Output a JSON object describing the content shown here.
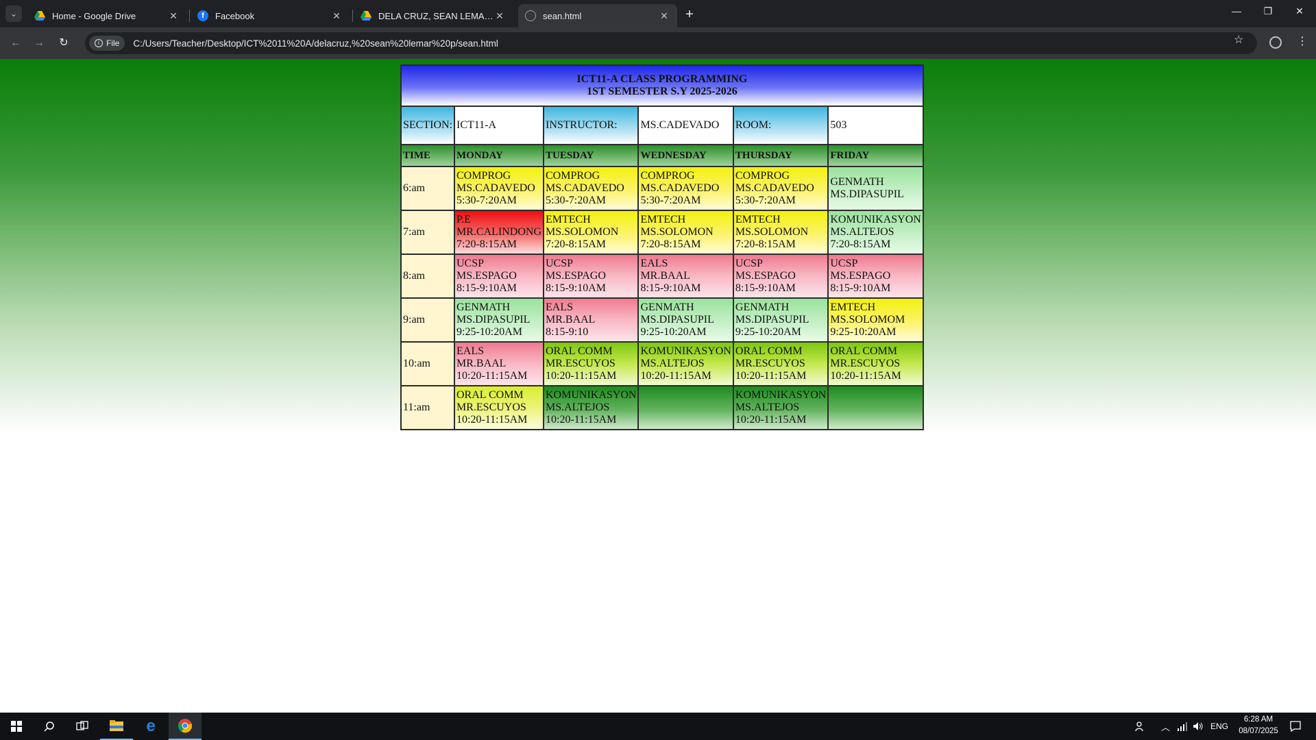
{
  "browser": {
    "tabs": [
      {
        "title": "Home - Google Drive",
        "icon": "google-drive-icon"
      },
      {
        "title": "Facebook",
        "icon": "facebook-icon"
      },
      {
        "title": "DELA CRUZ, SEAN LEMAR P. - G",
        "icon": "google-drive-icon"
      },
      {
        "title": "sean.html",
        "icon": "file-icon"
      }
    ],
    "new_tab": "+",
    "chip_label": "File",
    "url": "C:/Users/Teacher/Desktop/ICT%2011%20A/delacruz,%20sean%20lemar%20p/sean.html"
  },
  "schedule": {
    "title_line1": "ICT11-A CLASS PROGRAMMING",
    "title_line2": "1ST SEMESTER S.Y 2025-2026",
    "section_label": "SECTION:",
    "section_value": "ICT11-A",
    "instructor_label": "INSTRUCTOR:",
    "instructor_value": "MS.CADEVADO",
    "room_label": "ROOM:",
    "room_value": "503",
    "days": [
      "TIME",
      "MONDAY",
      "TUESDAY",
      "WEDNESDAY",
      "THURSDAY",
      "FRIDAY"
    ],
    "rows": [
      {
        "time": "6:am",
        "cells": [
          {
            "color": "#f3f10e",
            "lines": [
              "COMPROG",
              "MS.CADAVEDO",
              "5:30-7:20AM"
            ]
          },
          {
            "color": "#f3f10e",
            "lines": [
              "COMPROG",
              "MS.CADAVEDO",
              "5:30-7:20AM"
            ]
          },
          {
            "color": "#f3f10e",
            "lines": [
              "COMPROG",
              "MS.CADAVEDO",
              "5:30-7:20AM"
            ]
          },
          {
            "color": "#f3f10e",
            "lines": [
              "COMPROG",
              "MS.CADAVEDO",
              "5:30-7:20AM"
            ]
          },
          {
            "color": "#9ae39d",
            "lines": [
              "GENMATH",
              "MS.DIPASUPIL"
            ]
          }
        ]
      },
      {
        "time": "7:am",
        "cells": [
          {
            "color": "#f00f0f",
            "lines": [
              "P.E",
              "MR.CALINDONG",
              "7:20-8:15AM"
            ]
          },
          {
            "color": "#f3f10e",
            "lines": [
              "EMTECH",
              "MS.SOLOMON",
              "7:20-8:15AM"
            ]
          },
          {
            "color": "#f3f10e",
            "lines": [
              "EMTECH",
              "MS.SOLOMON",
              "7:20-8:15AM"
            ]
          },
          {
            "color": "#f3f10e",
            "lines": [
              "EMTECH",
              "MS.SOLOMON",
              "7:20-8:15AM"
            ]
          },
          {
            "color": "#9ae39d",
            "lines": [
              "KOMUNIKASYON",
              "MS.ALTEJOS",
              "7:20-8:15AM"
            ]
          }
        ]
      },
      {
        "time": "8:am",
        "cells": [
          {
            "color": "#f07a90",
            "lines": [
              "UCSP",
              "MS.ESPAGO",
              "8:15-9:10AM"
            ]
          },
          {
            "color": "#f07a90",
            "lines": [
              "UCSP",
              "MS.ESPAGO",
              "8:15-9:10AM"
            ]
          },
          {
            "color": "#f07a90",
            "lines": [
              "EALS",
              "MR.BAAL",
              "8:15-9:10AM"
            ]
          },
          {
            "color": "#f07a90",
            "lines": [
              "UCSP",
              "MS.ESPAGO",
              "8:15-9:10AM"
            ]
          },
          {
            "color": "#f07a90",
            "lines": [
              "UCSP",
              "MS.ESPAGO",
              "8:15-9:10AM"
            ]
          }
        ]
      },
      {
        "time": "9:am",
        "cells": [
          {
            "color": "#9ae39d",
            "lines": [
              "GENMATH",
              "MS.DIPASUPIL",
              "9:25-10:20AM"
            ]
          },
          {
            "color": "#f07a90",
            "lines": [
              "EALS",
              "MR.BAAL",
              "8:15-9:10"
            ]
          },
          {
            "color": "#9ae39d",
            "lines": [
              "GENMATH",
              "MS.DIPASUPIL",
              "9:25-10:20AM"
            ]
          },
          {
            "color": "#9ae39d",
            "lines": [
              "GENMATH",
              "MS.DIPASUPIL",
              "9:25-10:20AM"
            ]
          },
          {
            "color": "#f3f10e",
            "lines": [
              "EMTECH",
              "MS.SOLOMOM",
              "9:25-10:20AM"
            ]
          }
        ]
      },
      {
        "time": "10:am",
        "cells": [
          {
            "color": "#f07a90",
            "lines": [
              "EALS",
              "MR.BAAL",
              "10:20-11:15AM"
            ]
          },
          {
            "color": "#7dc70f",
            "lines": [
              "ORAL COMM",
              "MR.ESCUYOS",
              "10:20-11:15AM"
            ]
          },
          {
            "color": "#7dc70f",
            "lines": [
              "KOMUNIKASYON",
              "MS.ALTEJOS",
              "10:20-11:15AM"
            ]
          },
          {
            "color": "#7dc70f",
            "lines": [
              "ORAL COMM",
              "MR.ESCUYOS",
              "10:20-11:15AM"
            ]
          },
          {
            "color": "#7dc70f",
            "lines": [
              "ORAL COMM",
              "MR.ESCUYOS",
              "10:20-11:15AM"
            ]
          }
        ]
      },
      {
        "time": "11:am",
        "cells": [
          {
            "color": "#d9ee2c",
            "lines": [
              "ORAL COMM",
              "MR.ESCUYOS",
              "10:20-11:15AM"
            ]
          },
          {
            "color": "#1d8c1d",
            "lines": [
              "KOMUNIKASYON",
              "MS.ALTEJOS",
              "10:20-11:15AM"
            ]
          },
          {
            "color": "#1d8c1d",
            "lines": []
          },
          {
            "color": "#1d8c1d",
            "lines": [
              "KOMUNIKASYON",
              "MS.ALTEJOS",
              "10:20-11:15AM"
            ]
          },
          {
            "color": "#1d8c1d",
            "lines": []
          }
        ]
      }
    ]
  },
  "taskbar": {
    "lang": "ENG",
    "time": "6:28 AM",
    "date": "08/07/2025"
  }
}
